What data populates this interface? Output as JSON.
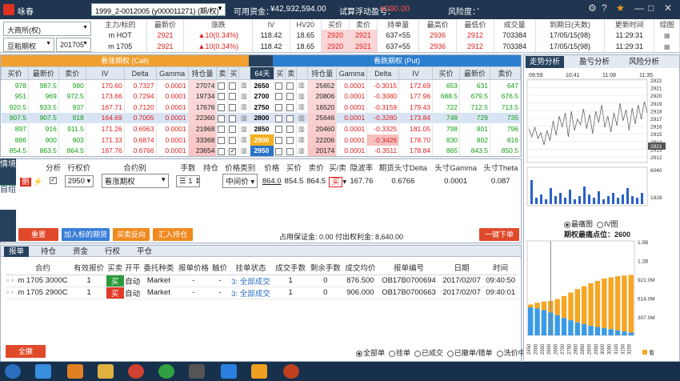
{
  "app": {
    "title": "咏春",
    "account": "1999_2-0012005 (y000011271) (期/权)",
    "available_label": "可用资金：",
    "available_value": "¥42,932,594.00",
    "trial_label": "试算浮动盈亏：",
    "trial_value": "¥290.00",
    "risk_label": "风险度：",
    "risk_value": "-"
  },
  "instrument": {
    "exchange": "大商所(权)",
    "product": "豆粕期权",
    "month": "201705",
    "headers": [
      "主力/标的",
      "最新价",
      "涨跌",
      "IV",
      "HV20",
      "买价",
      "卖价",
      "持单量",
      "最高价",
      "最低价",
      "成交量",
      "到期日(天数)",
      "更新时间",
      "综图"
    ],
    "rows": [
      [
        "m HOT",
        "2921",
        "▲10(0.34%)",
        "118.42",
        "18.65",
        "2920",
        "2921",
        "637×55",
        "2936",
        "2912",
        "703384",
        "17/05/15(98)",
        "11:29:31"
      ],
      [
        "m 1705",
        "2921",
        "▲10(0.34%)",
        "118.42",
        "18.65",
        "2920",
        "2921",
        "637×55",
        "2936",
        "2912",
        "703384",
        "17/05/15(98)",
        "11:29:31"
      ]
    ]
  },
  "chain": {
    "call_title": "看涨期权 (Call)",
    "put_title": "看跌期权 (Put)",
    "headers": [
      "买价",
      "最新价",
      "卖价",
      "IV",
      "Delta",
      "Gamma",
      "持仓量",
      "卖",
      "买",
      "",
      "64天",
      "买",
      "卖",
      "",
      "持仓量",
      "Gamma",
      "Delta",
      "IV",
      "买价",
      "最新价",
      "卖价"
    ],
    "rows": [
      {
        "c": [
          "978",
          "987.5",
          "980",
          "170.60",
          "0.7327",
          "0.0001",
          "27074"
        ],
        "k": "2650",
        "p": [
          "25652",
          "0.0001",
          "-0.3015",
          "172.69",
          "653",
          "631",
          "647"
        ]
      },
      {
        "c": [
          "951",
          "969",
          "972.5",
          "173.66",
          "0.7294",
          "0.0001",
          "19734"
        ],
        "k": "2700",
        "p": [
          "20806",
          "0.0001",
          "-0.3080",
          "177.96",
          "688.5",
          "679.5",
          "676.5"
        ]
      },
      {
        "c": [
          "920.5",
          "933.5",
          "937",
          "167.71",
          "0.7120",
          "0.0001",
          "17676"
        ],
        "k": "2750",
        "p": [
          "16520",
          "0.0001",
          "-0.3159",
          "179.43",
          "722",
          "712.5",
          "713.5"
        ]
      },
      {
        "c": [
          "907.5",
          "907.5",
          "918",
          "164.69",
          "0.7005",
          "0.0001",
          "22360"
        ],
        "k": "2800",
        "p": [
          "25646",
          "0.0001",
          "-0.3280",
          "173.84",
          "748",
          "729",
          "735"
        ]
      },
      {
        "c": [
          "897",
          "916",
          "911.5",
          "171.26",
          "0.6963",
          "0.0001",
          "21968"
        ],
        "k": "2850",
        "p": [
          "20460",
          "0.0001",
          "-0.3325",
          "181.05",
          "798",
          "801",
          "796"
        ]
      },
      {
        "c": [
          "886",
          "900",
          "903",
          "171.33",
          "0.6874",
          "0.0001",
          "33368"
        ],
        "k": "2900",
        "p": [
          "22206",
          "0.0001",
          "-0.3426",
          "178.70",
          "830",
          "802",
          "816"
        ]
      },
      {
        "c": [
          "854.5",
          "863.5",
          "864.5",
          "167.76",
          "0.6766",
          "0.0001",
          "23654"
        ],
        "k": "2950",
        "p": [
          "20174",
          "0.0001",
          "-0.3511",
          "178.84",
          "865",
          "843.5",
          "850.5"
        ]
      }
    ]
  },
  "order": {
    "side_tab1": "情境",
    "side_tab2": "自组",
    "headers": [
      "分析",
      "行权价",
      "合约别",
      "手数",
      "持仓",
      "价格类别",
      "价格",
      "买价",
      "卖价",
      "买/卖",
      "隐波率",
      "期货头寸Delta",
      "头寸Gamma",
      "头寸Theta"
    ],
    "row": {
      "strike": "2950",
      "type": "看涨期权",
      "qty": "1",
      "price_type": "中间价",
      "price": "864.0",
      "bid": "854.5",
      "ask": "864.5",
      "side": "买",
      "iv": "167.76",
      "delta": "0.6766",
      "gamma": "0.0001",
      "theta": "0.087"
    },
    "btn_reset": "重置",
    "btn_add_futures": "加入标的期货",
    "btn_reverse": "买卖反向",
    "btn_import": "汇入持仓",
    "margin_text": "占用保证金: 0.00 付出权利金: 8,640.00",
    "btn_submit": "一键下单"
  },
  "bottom": {
    "tabs": [
      "报单",
      "持仓",
      "资金",
      "行权",
      "平仓"
    ],
    "headers": [
      "合约",
      "有效报价",
      "买卖",
      "开平",
      "委托种类",
      "报单价格",
      "触价",
      "挂单状态",
      "成交手数",
      "剩余手数",
      "成交均价",
      "报单编号",
      "日期",
      "时间"
    ],
    "rows": [
      [
        "m 1705 3000C",
        "1",
        "买",
        "自动",
        "Market",
        "-",
        "-",
        "3: 全部成交",
        "1",
        "0",
        "876.500",
        "OB17B0700694",
        "2017/02/07",
        "09:40:50"
      ],
      [
        "m 1705 2900C",
        "1",
        "买",
        "自动",
        "Market",
        "-",
        "-",
        "3: 全部成交",
        "1",
        "0",
        "906.000",
        "OB17B0700663",
        "2017/02/07",
        "09:40:01"
      ]
    ],
    "btn_cancel_all": "全撤",
    "filters": [
      "全部单",
      "挂单",
      "已成交",
      "已撤单/错单",
      "洗价中"
    ]
  },
  "right": {
    "tabs": [
      "走势分析",
      "盈亏分析",
      "风险分析"
    ],
    "times": [
      "09:59",
      "10:41",
      "11:08",
      "11:35"
    ],
    "price_ticks": [
      "2922",
      "2921",
      "2920",
      "2919",
      "2918",
      "2917",
      "2916",
      "2915",
      "2914",
      "2913",
      "2912"
    ],
    "current_price": "2921",
    "vol_ticks": [
      "6040",
      "1828"
    ],
    "radio1": "最痛图",
    "radio2": "IV图",
    "maxpain_label": "期权最痛点位：2600",
    "bar_ticks": [
      "1.5B",
      "1.2B",
      "921.0M",
      "614.0M",
      "307.0M"
    ],
    "x_ticks": [
      "2450",
      "2500",
      "2550",
      "2600",
      "2650",
      "2700",
      "2750",
      "2800",
      "2850",
      "2900",
      "2950",
      "3000",
      "3050",
      "3100",
      "3150",
      "3200"
    ],
    "legend": "看"
  },
  "colors": {
    "up": "#e02020",
    "down": "#14a014",
    "call_header": "#f0a030",
    "put_header": "#2b7fd0",
    "nav": "#26415e"
  }
}
